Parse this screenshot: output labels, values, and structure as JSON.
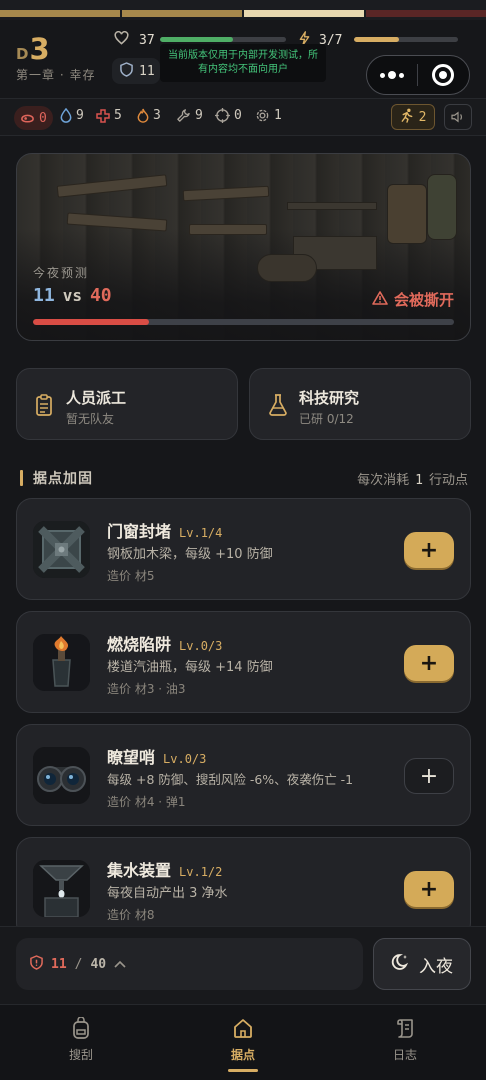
{
  "header": {
    "day_prefix": "D",
    "day_number": "3",
    "chapter": "第一章 · 幸存",
    "health": {
      "value": "37",
      "fill": 0.58,
      "color": "#4fae66"
    },
    "energy": {
      "value": "3/7",
      "fill": 0.43,
      "color": "#d7ad63"
    },
    "defense_chip": "11",
    "dev_notice": "当前版本仅用于内部开发测试，所有内容均不面向用户"
  },
  "top_strip": {
    "segments": [
      {
        "color": "#a8894d"
      },
      {
        "color": "#a8894d"
      },
      {
        "color": "#e9d9b1"
      },
      {
        "color": "#5a2626"
      }
    ]
  },
  "capsule": {
    "more_icon": "more-dots-icon",
    "close_icon": "target-icon"
  },
  "resources": {
    "food": "0",
    "water": "9",
    "medicine": "5",
    "fuel": "3",
    "parts": "9",
    "ammo": "0",
    "gear": "1",
    "action_points": "2"
  },
  "forecast": {
    "label": "今夜预测",
    "ours": "11",
    "vs": "vs",
    "theirs": "40",
    "warning": "会被撕开",
    "fill": 0.275
  },
  "actions": {
    "dispatch": {
      "title": "人员派工",
      "subtitle": "暂无队友"
    },
    "research": {
      "title": "科技研究",
      "subtitle": "已研 0/12"
    }
  },
  "fortify": {
    "title": "据点加固",
    "cost_prefix": "每次消耗",
    "cost_value": "1",
    "cost_suffix": "行动点",
    "items": [
      {
        "name": "门窗封堵",
        "level": "Lv.1/4",
        "desc": "钢板加木梁，每级 +10 防御",
        "cost": "造价  材5"
      },
      {
        "name": "燃烧陷阱",
        "level": "Lv.0/3",
        "desc": "楼道汽油瓶，每级 +14 防御",
        "cost": "造价  材3  ·  油3"
      },
      {
        "name": "瞭望哨",
        "level": "Lv.0/3",
        "desc": "每级 +8 防御、搜刮风险 -6%、夜袭伤亡 -1",
        "cost": "造价  材4  ·  弹1"
      },
      {
        "name": "集水装置",
        "level": "Lv.1/2",
        "desc": "每夜自动产出 3 净水",
        "cost": "造价  材8"
      }
    ],
    "plus": "+"
  },
  "defense_summary": {
    "current": "11",
    "slash": "/",
    "max": "40"
  },
  "night_button": "入夜",
  "tabs": [
    {
      "label": "搜刮",
      "icon": "backpack-icon"
    },
    {
      "label": "据点",
      "icon": "home-icon"
    },
    {
      "label": "日志",
      "icon": "scroll-icon"
    }
  ]
}
